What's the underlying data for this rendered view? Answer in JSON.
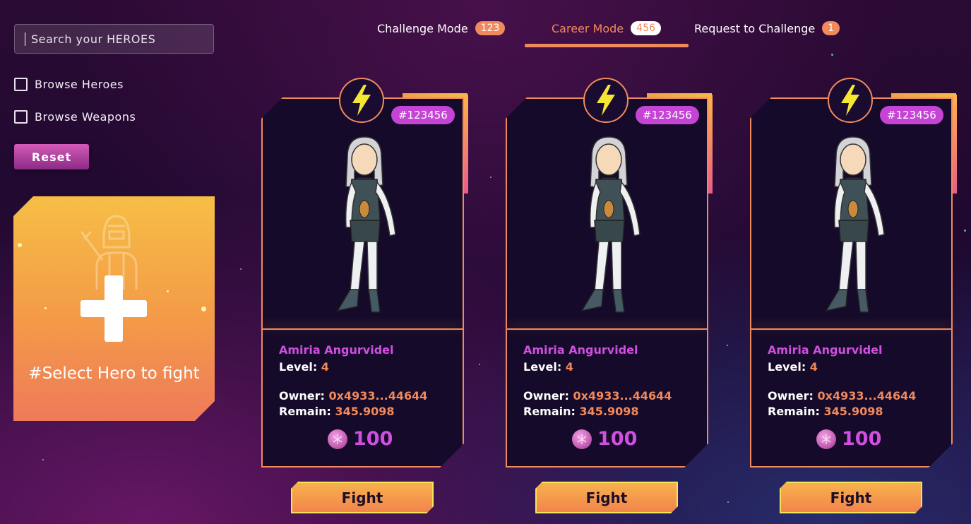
{
  "search": {
    "placeholder": "Search your HEROES"
  },
  "filters": [
    {
      "label": "Browse Heroes",
      "checked": false
    },
    {
      "label": "Browse Weapons",
      "checked": false
    }
  ],
  "reset_label": "Reset",
  "select_card": {
    "label": "#Select Hero to fight"
  },
  "tabs": [
    {
      "label": "Challenge Mode",
      "count": "123",
      "active": false
    },
    {
      "label": "Career Mode",
      "count": "456",
      "active": true
    },
    {
      "label": "Request to Challenge",
      "count": "1",
      "active": false
    }
  ],
  "heroes": [
    {
      "tag": "#123456",
      "name": "Amiria Angurvidel",
      "level_label": "Level:",
      "level": "4",
      "owner_label": "Owner:",
      "owner": "0x4933...44644",
      "remain_label": "Remain:",
      "remain": "345.9098",
      "price": "100",
      "fight_label": "Fight"
    },
    {
      "tag": "#123456",
      "name": "Amiria Angurvidel",
      "level_label": "Level:",
      "level": "4",
      "owner_label": "Owner:",
      "owner": "0x4933...44644",
      "remain_label": "Remain:",
      "remain": "345.9098",
      "price": "100",
      "fight_label": "Fight"
    },
    {
      "tag": "#123456",
      "name": "Amiria Angurvidel",
      "level_label": "Level:",
      "level": "4",
      "owner_label": "Owner:",
      "owner": "0x4933...44644",
      "remain_label": "Remain:",
      "remain": "345.9098",
      "price": "100",
      "fight_label": "Fight"
    }
  ],
  "colors": {
    "accent": "#f08a5d",
    "tag": "#c544d6",
    "name": "#d14fe0",
    "lightning": "#f5e632"
  },
  "icons": {
    "emblem": "lightning-icon",
    "coin": "token-coin-icon",
    "add": "plus-icon"
  }
}
